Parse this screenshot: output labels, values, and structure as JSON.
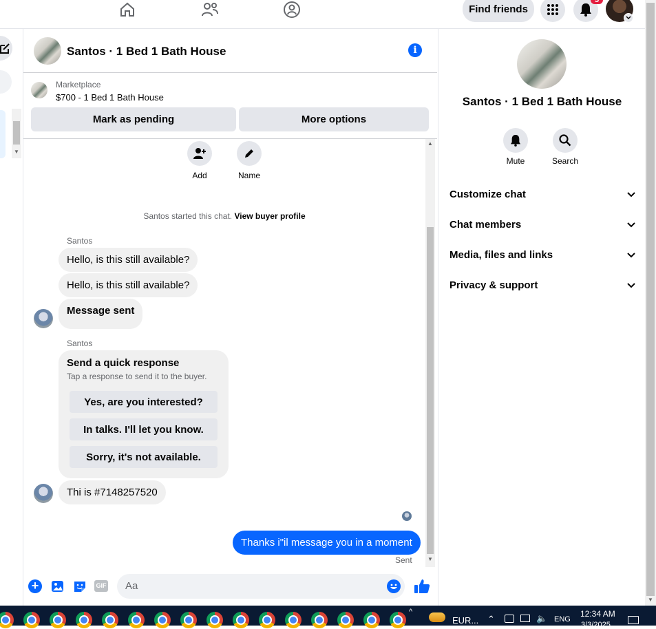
{
  "topbar": {
    "find_friends": "Find friends",
    "notifications_badge": "5"
  },
  "header": {
    "title": "Santos · 1 Bed 1 Bath House"
  },
  "listing": {
    "source": "Marketplace",
    "price_title": "$700 - 1 Bed 1 Bath House",
    "mark_pending": "Mark as pending",
    "more_options": "More options"
  },
  "actions": {
    "add": "Add",
    "name": "Name"
  },
  "thread": {
    "started_text": "Santos started this chat.",
    "view_profile": "View buyer profile",
    "sender1": "Santos",
    "msg1": "Hello, is this still available?",
    "msg2": "Hello, is this still available?",
    "msg3": "Message sent",
    "sender2": "Santos",
    "quick_title": "Send a quick response",
    "quick_sub": "Tap a response to send it to the buyer.",
    "quick_options": [
      "Yes, are you interested?",
      "In talks. I'll let you know.",
      "Sorry, it's not available."
    ],
    "msg4": "Thi is #7148257520",
    "outgoing": "Thanks i\"il message you in a moment",
    "status": "Sent"
  },
  "composer": {
    "placeholder": "Aa"
  },
  "panel": {
    "title": "Santos · 1 Bed 1 Bath House",
    "mute": "Mute",
    "search": "Search",
    "sections": [
      "Customize chat",
      "Chat members",
      "Media, files and links",
      "Privacy & support"
    ]
  },
  "taskbar": {
    "currency": "EUR...",
    "lang": "ENG",
    "time": "12:34 AM",
    "date": "3/3/2025"
  },
  "colors": {
    "accent": "#0866ff",
    "bubble_gray": "#f0f0f0",
    "button_gray": "#e4e6eb"
  }
}
